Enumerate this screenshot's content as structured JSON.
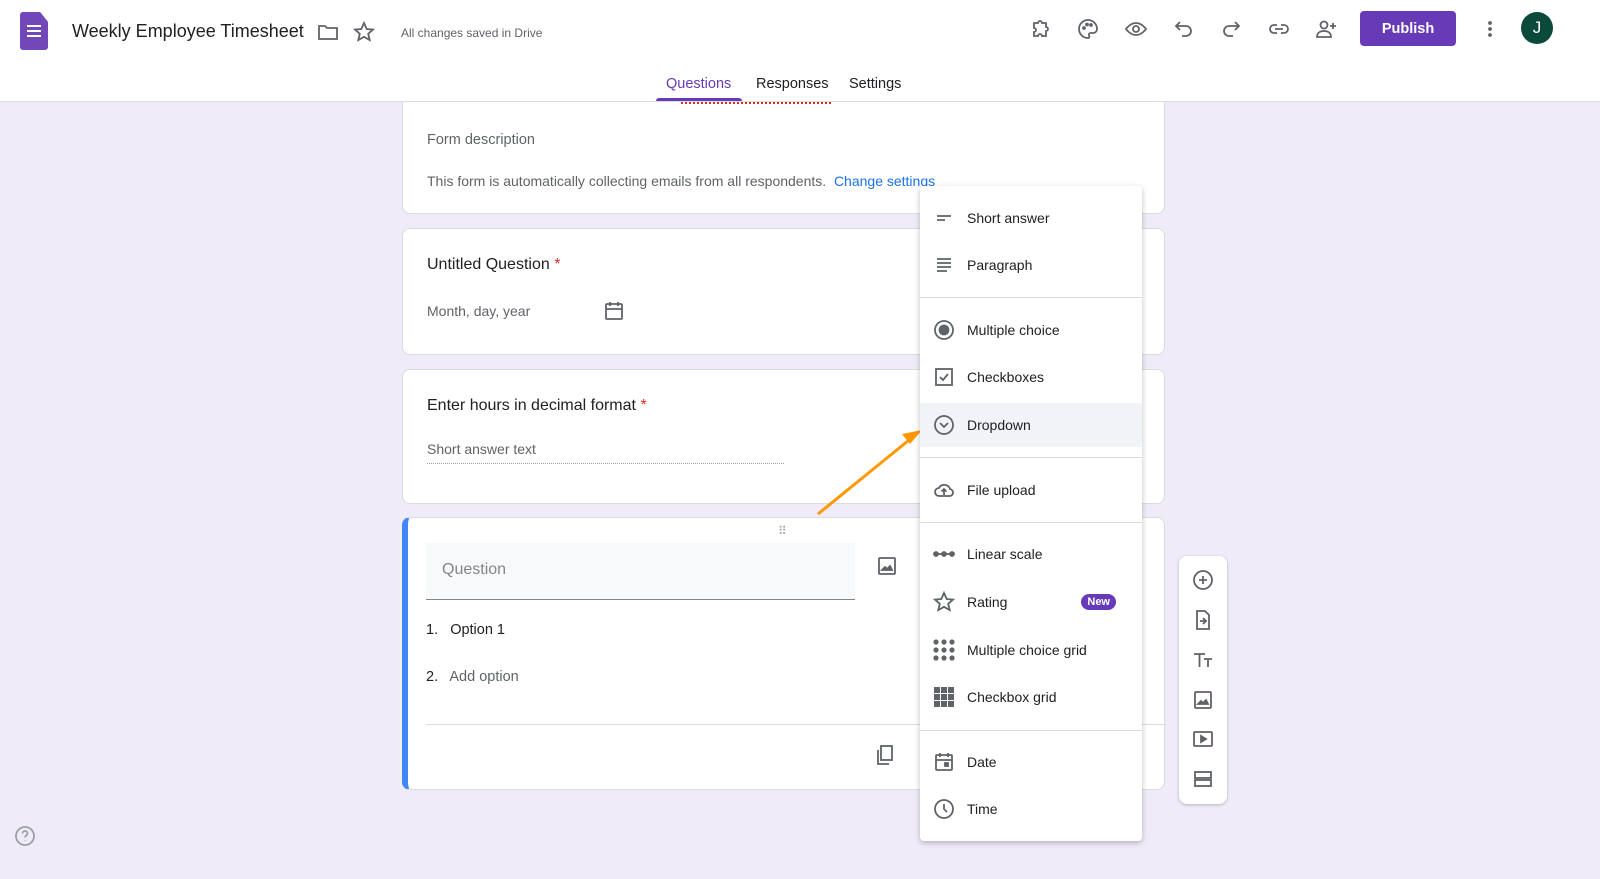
{
  "header": {
    "title": "Weekly Employee Timesheet",
    "save_status": "All changes saved in Drive",
    "publish_label": "Publish",
    "avatar_initial": "J",
    "tabs": [
      "Questions",
      "Responses",
      "Settings"
    ]
  },
  "form_header": {
    "description": "Form description",
    "email_notice": "This form is automatically collecting emails from all respondents.",
    "change_settings": "Change settings"
  },
  "questions": [
    {
      "title": "Untitled Question",
      "required": "*",
      "placeholder": "Month, day, year"
    },
    {
      "title": "Enter hours in decimal format",
      "required": "*",
      "placeholder": "Short answer text"
    },
    {
      "placeholder": "Question",
      "options": [
        {
          "num": "1.",
          "label": "Option 1"
        },
        {
          "num": "2.",
          "label": "Add option"
        }
      ]
    }
  ],
  "type_menu": [
    {
      "label": "Short answer",
      "icon": "short-answer-icon"
    },
    {
      "label": "Paragraph",
      "icon": "paragraph-icon"
    },
    {
      "label": "Multiple choice",
      "icon": "radio-icon"
    },
    {
      "label": "Checkboxes",
      "icon": "checkbox-icon"
    },
    {
      "label": "Dropdown",
      "icon": "dropdown-icon"
    },
    {
      "label": "File upload",
      "icon": "cloud-upload-icon"
    },
    {
      "label": "Linear scale",
      "icon": "linear-scale-icon"
    },
    {
      "label": "Rating",
      "icon": "star-icon",
      "badge": "New"
    },
    {
      "label": "Multiple choice grid",
      "icon": "dot-grid-icon"
    },
    {
      "label": "Checkbox grid",
      "icon": "square-grid-icon"
    },
    {
      "label": "Date",
      "icon": "calendar-icon"
    },
    {
      "label": "Time",
      "icon": "clock-icon"
    }
  ],
  "colors": {
    "accent": "#673ab7",
    "background": "#f0ebf8",
    "focus": "#4285f4",
    "arrow": "#ff9800",
    "link": "#1a73e8"
  }
}
